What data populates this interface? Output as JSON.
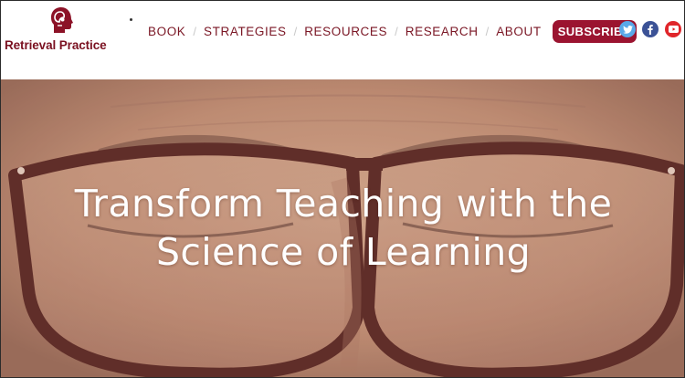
{
  "brand": {
    "name": "Retrieval Practice",
    "accent_color": "#7a1020",
    "logo_icon": "head-profile-icon"
  },
  "nav": {
    "items": [
      {
        "label": "BOOK"
      },
      {
        "label": "STRATEGIES"
      },
      {
        "label": "RESOURCES"
      },
      {
        "label": "RESEARCH"
      },
      {
        "label": "ABOUT"
      }
    ],
    "separator": "/",
    "subscribe_label": "SUBSCRIBE",
    "subscribe_color": "#9b1430"
  },
  "social": [
    {
      "icon": "twitter-icon",
      "color": "#5aa8e8"
    },
    {
      "icon": "facebook-icon",
      "color": "#3b5296"
    },
    {
      "icon": "youtube-icon",
      "color": "#e0262b"
    }
  ],
  "hero": {
    "background": "close-up-face-with-glasses-photo",
    "headline_line1": "Transform Teaching with the",
    "headline_line2": "Science of Learning"
  }
}
